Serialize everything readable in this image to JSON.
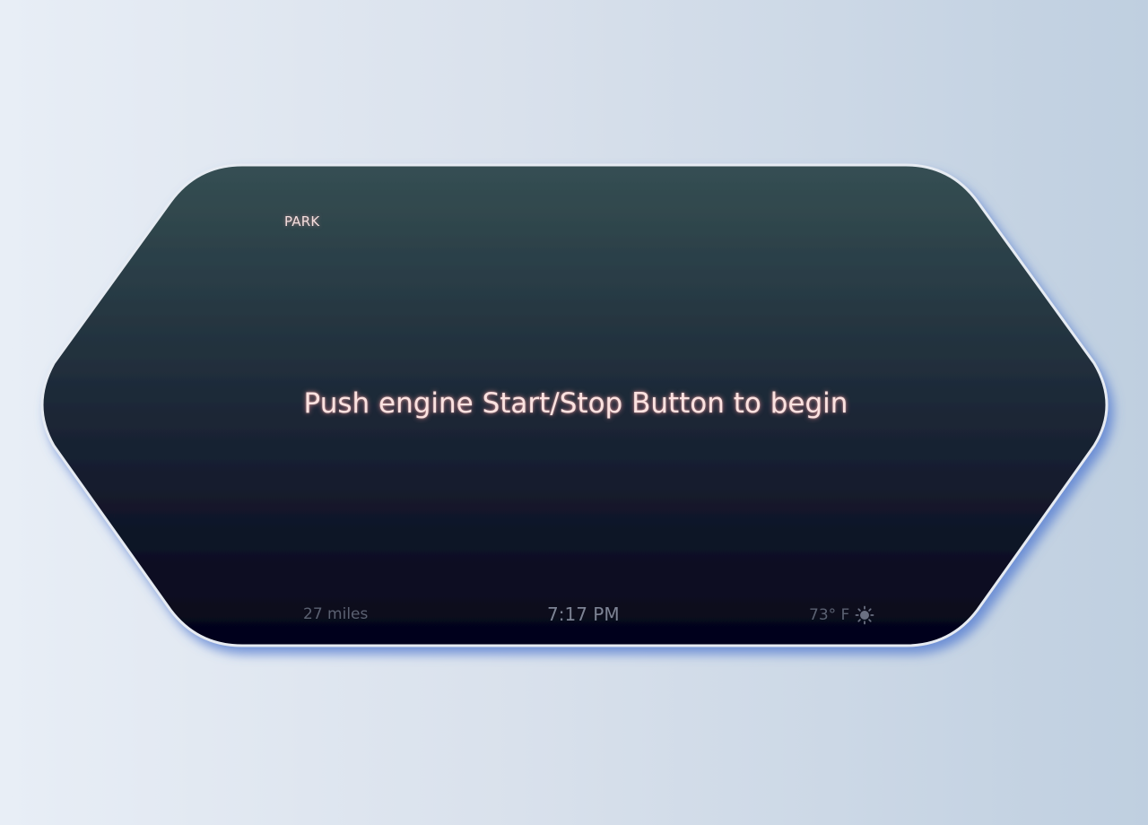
{
  "gear": "PARK",
  "prompt": "Push engine Start/Stop Button to begin",
  "status_bar": {
    "range": "27 miles",
    "time": "7:17 PM",
    "temperature": "73° F",
    "weather_icon": "sun-icon"
  },
  "colors": {
    "panel_top": "#354f53",
    "panel_bottom": "#04031a",
    "prompt_text": "#fbe2e0",
    "glow": "#ff9a9a"
  }
}
